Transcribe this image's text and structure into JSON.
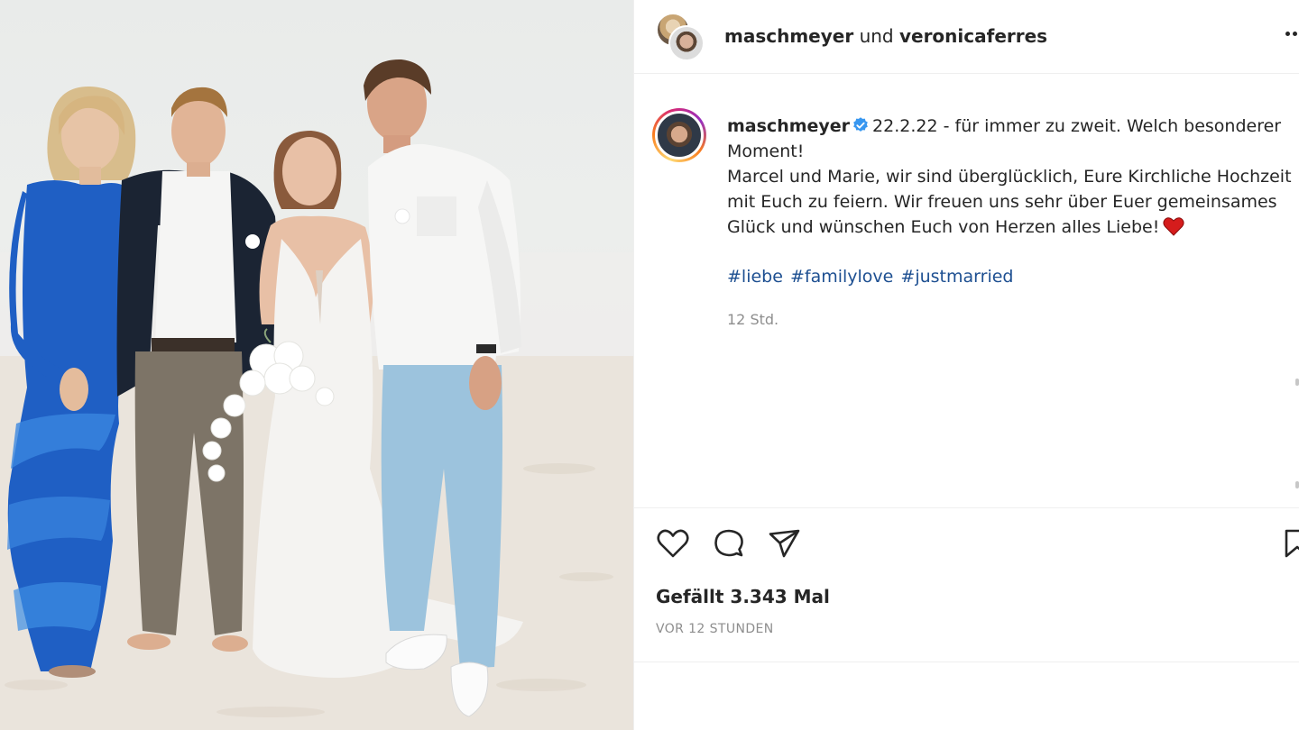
{
  "header": {
    "user1": "maschmeyer",
    "connector": "und",
    "user2": "veronicaferres",
    "avatar_icons": [
      "avatar-veronicaferres",
      "avatar-maschmeyer"
    ],
    "more_icon": "more-horizontal-icon"
  },
  "caption": {
    "username": "maschmeyer",
    "verified_icon": "verified-badge-icon",
    "lines": [
      "22.2.22 - für immer zu zweit. Welch besonderer",
      "Moment!",
      "Marcel und Marie, wir sind überglücklich, Eure Kirchliche Hochzeit",
      "mit Euch zu feiern. Wir freuen uns sehr über Euer gemeinsames",
      "Glück und wünschen Euch von Herzen alles Liebe!"
    ],
    "emoji": "red-heart-emoji",
    "hashtags": [
      "#liebe",
      "#familylove",
      "#justmarried"
    ],
    "time": "12 Std."
  },
  "actions": {
    "icons": [
      "heart-icon",
      "comment-icon",
      "share-icon",
      "bookmark-icon"
    ],
    "likes": "Gefällt 3.343 Mal",
    "date": "VOR 12 STUNDEN"
  },
  "photo": {
    "scene": "wedding-group-photo-beach",
    "colors": {
      "sky": "#e9ebea",
      "sand": "#e6e0d8",
      "blue_dress": "#1f5fc4",
      "jacket": "#1b2433",
      "trousers_grey": "#7d7467",
      "wedding_dress": "#f4f3f1",
      "jeans": "#9cc3dd"
    }
  },
  "colors": {
    "text": "#262626",
    "secondary": "#8e8e8e",
    "hashtag": "#1d4f91",
    "verified": "#3897f0",
    "separator": "#efefef"
  }
}
